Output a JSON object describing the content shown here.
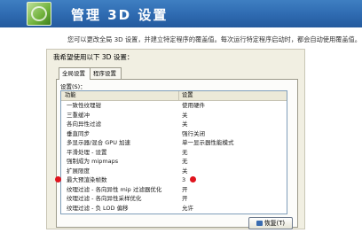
{
  "header": {
    "title": "管理 3D 设置"
  },
  "description": "您可以更改全局 3D 设置，并建立特定程序的覆盖值。每次运行特定程序启动时，都会自动使用覆盖值。",
  "panel": {
    "label": "我希望使用以下 3D 设置：",
    "tabs": [
      "全局设置",
      "程序设置"
    ],
    "list_label": "设置(S)：",
    "columns": {
      "feature": "功能",
      "setting": "设置"
    },
    "rows": [
      {
        "feature": "一致性纹理钳",
        "setting": "使用硬件"
      },
      {
        "feature": "三重缓冲",
        "setting": "关"
      },
      {
        "feature": "各向异性过滤",
        "setting": "关"
      },
      {
        "feature": "垂直同步",
        "setting": "强行关闭"
      },
      {
        "feature": "多显示器/混合 GPU 加速",
        "setting": "单一显示器性能模式"
      },
      {
        "feature": "平滑处理 - 设置",
        "setting": "无"
      },
      {
        "feature": "强制成为 mipmaps",
        "setting": "无"
      },
      {
        "feature": "扩展限度",
        "setting": "关"
      },
      {
        "feature": "最大预渲染帧数",
        "setting": "3"
      },
      {
        "feature": "纹理过滤 - 各向异性 mip 过滤器优化",
        "setting": "开"
      },
      {
        "feature": "纹理过滤 - 各向异性采样优化",
        "setting": "开"
      },
      {
        "feature": "纹理过滤 - 负 LOD 偏移",
        "setting": "允许"
      }
    ],
    "restore_button": "恢复(T)"
  },
  "colors": {
    "header": "#2e6ab0",
    "marker": "#e0141e"
  },
  "icons": {
    "header": "nvidia-settings-icon",
    "restore": "restore-icon",
    "marker": "red-highlight-dot"
  }
}
